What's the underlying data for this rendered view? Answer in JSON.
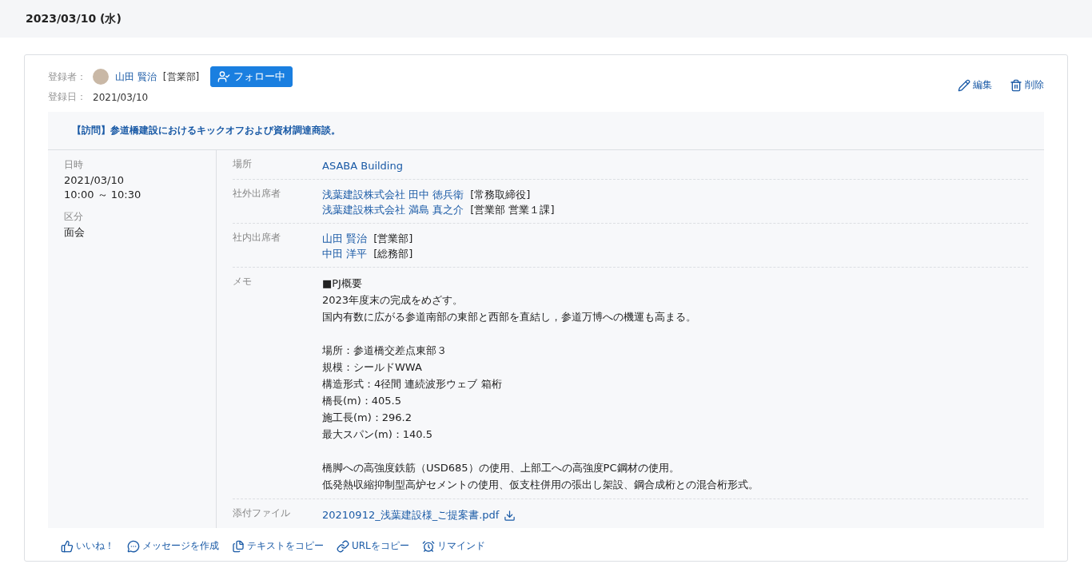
{
  "date_header": "2023/03/10 (水)",
  "record": {
    "registrant_label": "登録者：",
    "registrant_name": "山田 賢治",
    "registrant_dept": "[営業部]",
    "follow_button": {
      "label": "フォロー中",
      "on": true
    },
    "registered_label": "登録日：",
    "registered_date": "2021/03/10",
    "actions": [
      {
        "kind": "edit",
        "label": "編集"
      },
      {
        "kind": "delete",
        "label": "削除"
      }
    ]
  },
  "title": "【訪問】参道橋建設におけるキックオフおよび資材調達商談。",
  "summary": [
    {
      "label": "日時",
      "lines": [
        "2021/03/10",
        "10:00 ～ 10:30"
      ]
    },
    {
      "label": "区分",
      "lines": [
        "面会"
      ]
    }
  ],
  "details": [
    {
      "kind": "link",
      "label": "場所",
      "value": "ASABA Building"
    },
    {
      "kind": "people",
      "label": "社外出席者",
      "people": [
        {
          "name": "浅葉建設株式会社  田中 徳兵衛",
          "role": "[常務取締役]"
        },
        {
          "name": "浅葉建設株式会社  満島 真之介",
          "role": "[営業部 営業１課]"
        }
      ]
    },
    {
      "kind": "people",
      "label": "社内出席者",
      "people": [
        {
          "name": "山田 賢治",
          "role": "[営業部]"
        },
        {
          "name": "中田 洋平",
          "role": "[総務部]"
        }
      ]
    },
    {
      "kind": "memo",
      "label": "メモ",
      "paragraphs": [
        [
          "■PJ概要",
          "2023年度末の完成をめざす。",
          "国内有数に広がる参道南部の東部と西部を直結し，参道万博への機運も高まる。"
        ],
        [
          "場所：参道橋交差点東部３",
          "規模：シールドWWA",
          "構造形式：4径間 連続波形ウェブ 箱桁",
          "橋長(m)：405.5",
          "施工長(m)：296.2",
          "最大スパン(m)：140.5"
        ],
        [
          "橋脚への高強度鉄筋（USD685）の使用、上部工への高強度PC鋼材の使用。",
          "低発熱収縮抑制型高炉セメントの使用、仮支柱併用の張出し架設、鋼合成桁との混合桁形式。"
        ]
      ]
    },
    {
      "kind": "file",
      "label": "添付ファイル",
      "value": "20210912_浅葉建設様_ご提案書.pdf"
    }
  ],
  "footer_actions": [
    {
      "kind": "like",
      "label": "いいね！"
    },
    {
      "kind": "message",
      "label": "メッセージを作成"
    },
    {
      "kind": "copy_text",
      "label": "テキストをコピー"
    },
    {
      "kind": "copy_url",
      "label": "URLをコピー"
    },
    {
      "kind": "remind",
      "label": "リマインド"
    }
  ]
}
